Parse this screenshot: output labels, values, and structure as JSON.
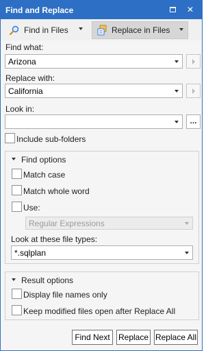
{
  "window": {
    "title": "Find and Replace"
  },
  "tabs": [
    {
      "label": "Find in Files",
      "icon": "find-in-files-icon"
    },
    {
      "label": "Replace in Files",
      "icon": "replace-in-files-icon",
      "active": true
    }
  ],
  "find": {
    "label": "Find what:",
    "value": "Arizona"
  },
  "replace": {
    "label": "Replace with:",
    "value": "California"
  },
  "look_in": {
    "label": "Look in:",
    "value": "",
    "browse_label": "..."
  },
  "include_subfolders": {
    "label": "Include sub-folders",
    "checked": false
  },
  "find_options": {
    "title": "Find options",
    "match_case": {
      "label": "Match case",
      "checked": false
    },
    "match_whole_word": {
      "label": "Match whole word",
      "checked": false
    },
    "use": {
      "label": "Use:",
      "checked": false
    },
    "use_mode": {
      "value": "Regular Expressions",
      "disabled": true
    },
    "file_types": {
      "label": "Look at these file types:",
      "value": "*.sqlplan"
    }
  },
  "result_options": {
    "title": "Result options",
    "display_file_names_only": {
      "label": "Display file names only",
      "checked": false
    },
    "keep_modified_open": {
      "label": "Keep modified files open after Replace All",
      "checked": false
    }
  },
  "buttons": {
    "find_next": "Find Next",
    "replace": "Replace",
    "replace_all": "Replace All"
  },
  "colors": {
    "titlebar": "#2d6fc4",
    "background": "#f5f5f5",
    "active_tab": "#d6d6d6"
  }
}
